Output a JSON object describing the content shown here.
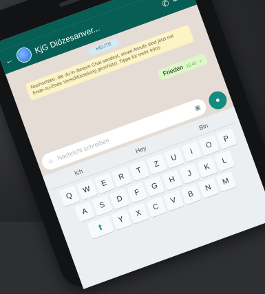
{
  "app": {
    "chat_title": "KjG Diözesanver...",
    "date_pill": "HEUTE",
    "encryption_notice": "Nachrichten, die du in diesem Chat sendest, sowie Anrufe sind jetzt mit Ende-zu-Ende-Verschlüsselung geschützt. Tippe für mehr Infos.",
    "message_text": "Frieden",
    "message_time": "15:49",
    "input_placeholder": "Nachricht schreiben",
    "suggestions": [
      "Ich",
      "Hey",
      "Bin"
    ],
    "rows": [
      [
        "Q",
        "W",
        "E",
        "R",
        "T",
        "Z",
        "U",
        "I",
        "O",
        "P"
      ],
      [
        "A",
        "S",
        "D",
        "F",
        "G",
        "H",
        "J",
        "K",
        "L"
      ],
      [
        "Y",
        "X",
        "C",
        "V",
        "B",
        "N",
        "M"
      ]
    ],
    "accent_color": "#075e54"
  }
}
